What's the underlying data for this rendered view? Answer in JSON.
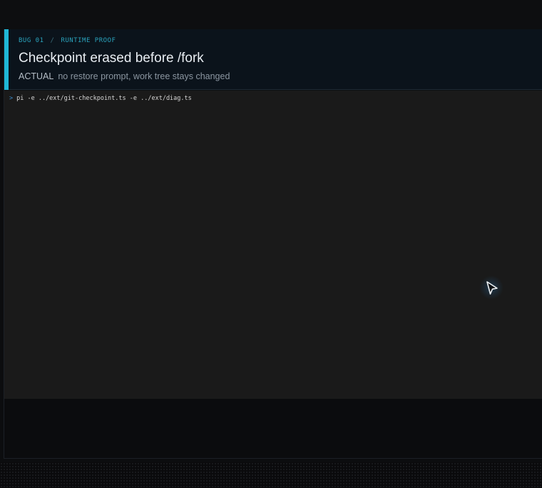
{
  "header": {
    "eyebrow_bug": "BUG 01",
    "eyebrow_sep": "/",
    "eyebrow_section": "RUNTIME PROOF",
    "title": "Checkpoint erased before /fork",
    "subtitle_label": "ACTUAL",
    "subtitle_text": "no restore prompt, work tree stays changed"
  },
  "terminal": {
    "prompt": ">",
    "command": "pi -e ../ext/git-checkpoint.ts -e ../ext/diag.ts"
  },
  "colors": {
    "accent": "#1fb7d6",
    "terminal_bg": "#1a1a1a",
    "prompt": "#3c8fd1"
  },
  "icons": {
    "cursor": "mouse-pointer-icon"
  }
}
